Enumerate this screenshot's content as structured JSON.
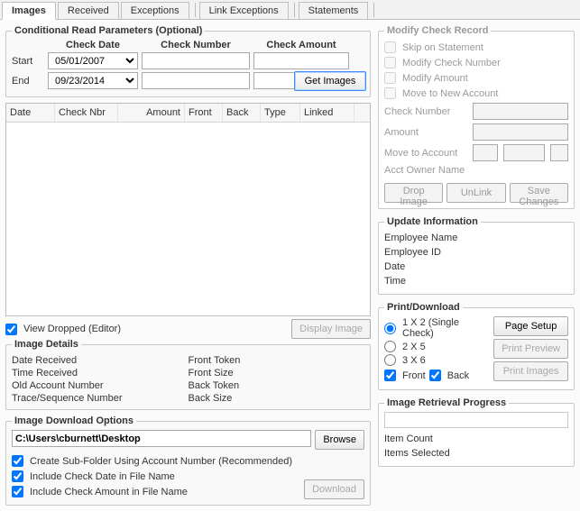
{
  "tabs": {
    "images": "Images",
    "received": "Received",
    "exceptions": "Exceptions",
    "link_exceptions": "Link Exceptions",
    "statements": "Statements"
  },
  "cond": {
    "legend": "Conditional Read Parameters (Optional)",
    "check_date": "Check Date",
    "check_number": "Check Number",
    "check_amount": "Check Amount",
    "start": "Start",
    "end": "End",
    "start_date": "05/01/2007",
    "end_date": "09/23/2014",
    "get_images": "Get Images"
  },
  "table": {
    "date": "Date",
    "check_nbr": "Check Nbr",
    "amount": "Amount",
    "front": "Front",
    "back": "Back",
    "type": "Type",
    "linked": "Linked"
  },
  "view_dropped": "View Dropped (Editor)",
  "display_image": "Display Image",
  "details": {
    "legend": "Image Details",
    "date_received": "Date Received",
    "time_received": "Time Received",
    "old_account": "Old Account Number",
    "trace": "Trace/Sequence Number",
    "front_token": "Front Token",
    "front_size": "Front Size",
    "back_token": "Back Token",
    "back_size": "Back Size"
  },
  "download_opts": {
    "legend": "Image Download Options",
    "path": "C:\\Users\\cburnett\\Desktop",
    "browse": "Browse",
    "opt1": "Create Sub-Folder Using Account Number (Recommended)",
    "opt2": "Include Check Date in File Name",
    "opt3": "Include Check Amount in File Name",
    "download": "Download"
  },
  "modify": {
    "legend": "Modify Check Record",
    "skip": "Skip on Statement",
    "mod_num": "Modify Check Number",
    "mod_amt": "Modify Amount",
    "move_new": "Move to New Account",
    "check_number": "Check Number",
    "amount": "Amount",
    "move_to": "Move to Account",
    "owner": "Acct Owner Name",
    "drop": "Drop Image",
    "unlink": "UnLink",
    "save": "Save Changes"
  },
  "update": {
    "legend": "Update Information",
    "emp_name": "Employee Name",
    "emp_id": "Employee ID",
    "date": "Date",
    "time": "Time"
  },
  "pd": {
    "legend": "Print/Download",
    "r1": "1 X 2 (Single Check)",
    "r2": "2 X 5",
    "r3": "3 X 6",
    "front": "Front",
    "back": "Back",
    "page_setup": "Page Setup",
    "preview": "Print Preview",
    "print": "Print Images"
  },
  "prog": {
    "legend": "Image Retrieval Progress",
    "item_count": "Item Count",
    "items_selected": "Items Selected"
  }
}
